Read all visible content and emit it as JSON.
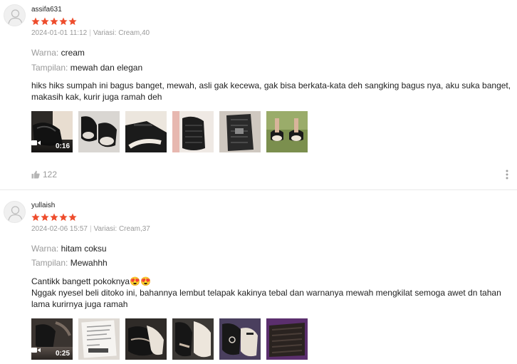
{
  "colors": {
    "star": "#ee4d2d",
    "muted": "#9a9a9a",
    "text": "#222222",
    "divider": "#e9e9e9"
  },
  "reviews": [
    {
      "username": "assifa631",
      "rating": 5,
      "timestamp": "2024-01-01 11:12",
      "variant": "Variasi: Cream,40",
      "attributes": [
        {
          "label": "Warna:",
          "value": "cream"
        },
        {
          "label": "Tampilan:",
          "value": "mewah dan elegan"
        }
      ],
      "comment": [
        "hiks hiks sumpah ini bagus banget, mewah, asli gak kecewa, gak bisa berkata-kata deh sangking bagus nya, aku suka banget, makasih kak, kurir juga ramah deh"
      ],
      "video_duration": "0:16",
      "media_icons": [
        "video-icon",
        "photo",
        "photo",
        "photo",
        "photo",
        "photo"
      ],
      "likes": "122"
    },
    {
      "username": "yullaish",
      "rating": 5,
      "timestamp": "2024-02-06 15:57",
      "variant": "Variasi: Cream,37",
      "attributes": [
        {
          "label": "Warna:",
          "value": "hitam coksu"
        },
        {
          "label": "Tampilan:",
          "value": "Mewahhh"
        }
      ],
      "comment": [
        "Cantikk bangett pokoknya😍😍",
        "Nggak nyesel beli ditoko ini, bahannya lembut telapak kakinya tebal dan warnanya mewah mengkilat semoga awet dn tahan lama kurirnya juga ramah"
      ],
      "video_duration": "0:25",
      "media_icons": [
        "video-icon",
        "photo",
        "photo",
        "photo",
        "photo",
        "photo"
      ]
    }
  ]
}
